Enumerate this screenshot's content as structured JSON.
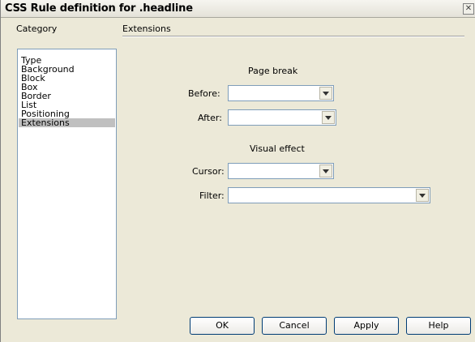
{
  "window": {
    "title": "CSS Rule definition for .headline",
    "close_icon": "close-icon"
  },
  "category": {
    "header": "Category",
    "items": [
      "Type",
      "Background",
      "Block",
      "Box",
      "Border",
      "List",
      "Positioning",
      "Extensions"
    ],
    "selected": "Extensions"
  },
  "extensions": {
    "section_title": "Extensions",
    "page_break": {
      "heading": "Page break",
      "before_label": "Before:",
      "before_value": "",
      "after_label": "After:",
      "after_value": ""
    },
    "visual_effect": {
      "heading": "Visual effect",
      "cursor_label": "Cursor:",
      "cursor_value": "",
      "filter_label": "Filter:",
      "filter_value": ""
    }
  },
  "buttons": {
    "ok": "OK",
    "cancel": "Cancel",
    "apply": "Apply",
    "help": "Help"
  },
  "colors": {
    "dialog_bg": "#ece9d8",
    "selected_item_bg": "#c0c0c0",
    "field_border": "#7f9db9"
  }
}
